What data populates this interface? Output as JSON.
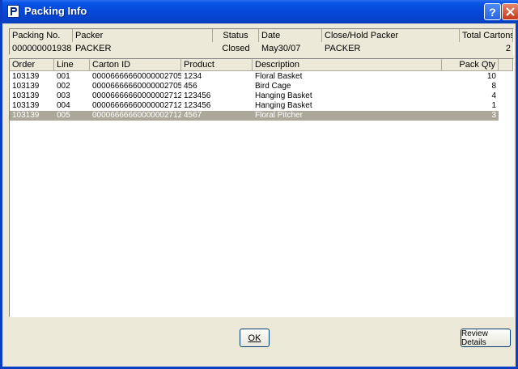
{
  "window": {
    "title": "Packing Info"
  },
  "summary": {
    "headers": {
      "packing_no": "Packing No.",
      "packer": "Packer",
      "status": "Status",
      "date": "Date",
      "close_hold_packer": "Close/Hold Packer",
      "total_cartons": "Total Cartons"
    },
    "values": {
      "packing_no": "000000001938",
      "packer": "PACKER",
      "status": "Closed",
      "date": "May30/07",
      "close_hold_packer": "PACKER",
      "total_cartons": "2"
    }
  },
  "grid": {
    "headers": {
      "order": "Order",
      "line": "Line",
      "carton_id": "Carton ID",
      "product": "Product",
      "description": "Description",
      "pack_qty": "Pack Qty"
    },
    "rows": [
      {
        "order": "103139",
        "line": "001",
        "carton_id": "00006666660000002705",
        "product": "1234",
        "description": "Floral Basket",
        "pack_qty": "10"
      },
      {
        "order": "103139",
        "line": "002",
        "carton_id": "00006666660000002705",
        "product": "456",
        "description": "Bird Cage",
        "pack_qty": "8"
      },
      {
        "order": "103139",
        "line": "003",
        "carton_id": "00006666660000002712",
        "product": "123456",
        "description": "Hanging Basket",
        "pack_qty": "4"
      },
      {
        "order": "103139",
        "line": "004",
        "carton_id": "00006666660000002712",
        "product": "123456",
        "description": "Hanging Basket",
        "pack_qty": "1"
      },
      {
        "order": "103139",
        "line": "005",
        "carton_id": "00006666660000002712",
        "product": "4567",
        "description": "Floral Pitcher",
        "pack_qty": "3"
      }
    ],
    "selected_row": 5
  },
  "buttons": {
    "ok": "OK",
    "review_details": "Review Details"
  },
  "colors": {
    "titlebar": "#0548d9",
    "face": "#ece9d8",
    "selected_row": "#aca899"
  }
}
